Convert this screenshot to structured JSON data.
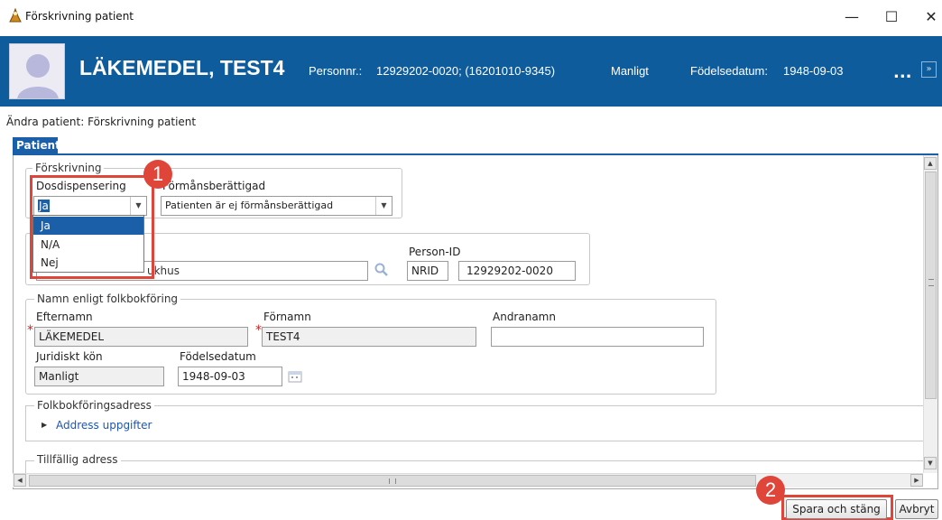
{
  "window": {
    "title": "Förskrivning patient",
    "minimize": "—",
    "maximize": "☐",
    "close": "✕"
  },
  "header": {
    "patient_name": "LÄKEMEDEL, TEST4",
    "personnr_label": "Personnr.:",
    "personnr_value": "12929202-0020; (16201010-9345)",
    "gender": "Manligt",
    "birthdate_label": "Födelsedatum:",
    "birthdate_value": "1948-09-03",
    "more": "...",
    "expand": "»"
  },
  "page": {
    "subtitle": "Ändra patient: Förskrivning patient",
    "tab": "Patient"
  },
  "forskrivning": {
    "legend": "Förskrivning",
    "dos_label": "Dosdispensering",
    "dos_value": "Ja",
    "dos_options": [
      "Ja",
      "N/A",
      "Nej"
    ],
    "forman_label": "Förmånsberättigad",
    "forman_value": "Patienten är ej förmånsberättigad"
  },
  "vardenhet": {
    "unit_value": "Locus Akademiska sjukhus",
    "unit_visible_suffix": "ukhus",
    "personid_label": "Person-ID",
    "personid_type": "NRID",
    "personid_value": "12929202-0020"
  },
  "namn": {
    "legend": "Namn enligt folkbokföring",
    "efternamn_label": "Efternamn",
    "efternamn_value": "LÄKEMEDEL",
    "fornamn_label": "Förnamn",
    "fornamn_value": "TEST4",
    "andranamn_label": "Andranamn",
    "andranamn_value": "",
    "kon_label": "Juridiskt kön",
    "kon_value": "Manligt",
    "fodelse_label": "Födelsedatum",
    "fodelse_value": "1948-09-03"
  },
  "folkbokforing": {
    "legend": "Folkbokföringsadress",
    "link": "Address uppgifter"
  },
  "tillfallig": {
    "legend": "Tillfällig adress"
  },
  "buttons": {
    "save": "Spara och stäng",
    "cancel": "Avbryt"
  },
  "badges": {
    "one": "1",
    "two": "2"
  },
  "colors": {
    "header_bg": "#0f5c9c",
    "accent": "#1b5fa8",
    "highlight": "#e0453a",
    "link": "#1a56b8"
  }
}
